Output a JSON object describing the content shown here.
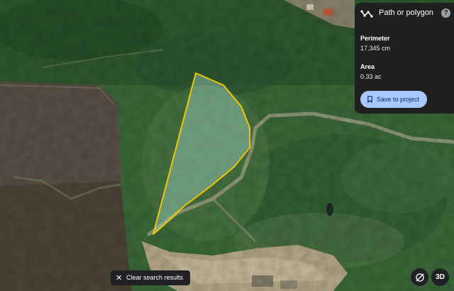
{
  "panel": {
    "title": "Path or polygon",
    "help_icon": "help-icon",
    "path_icon": "path-polygon-icon",
    "help_glyph": "?",
    "perimeter_label": "Perimeter",
    "perimeter_value": "17,345 cm",
    "area_label": "Area",
    "area_value": "0.33 ac",
    "save_label": "Save to project",
    "save_icon": "bookmark-icon"
  },
  "map": {
    "clear_label": "Clear search results",
    "clear_icon": "close-icon",
    "compass_icon": "compass-icon",
    "view_3d_label": "3D",
    "polygon_color": "#f2c500"
  }
}
